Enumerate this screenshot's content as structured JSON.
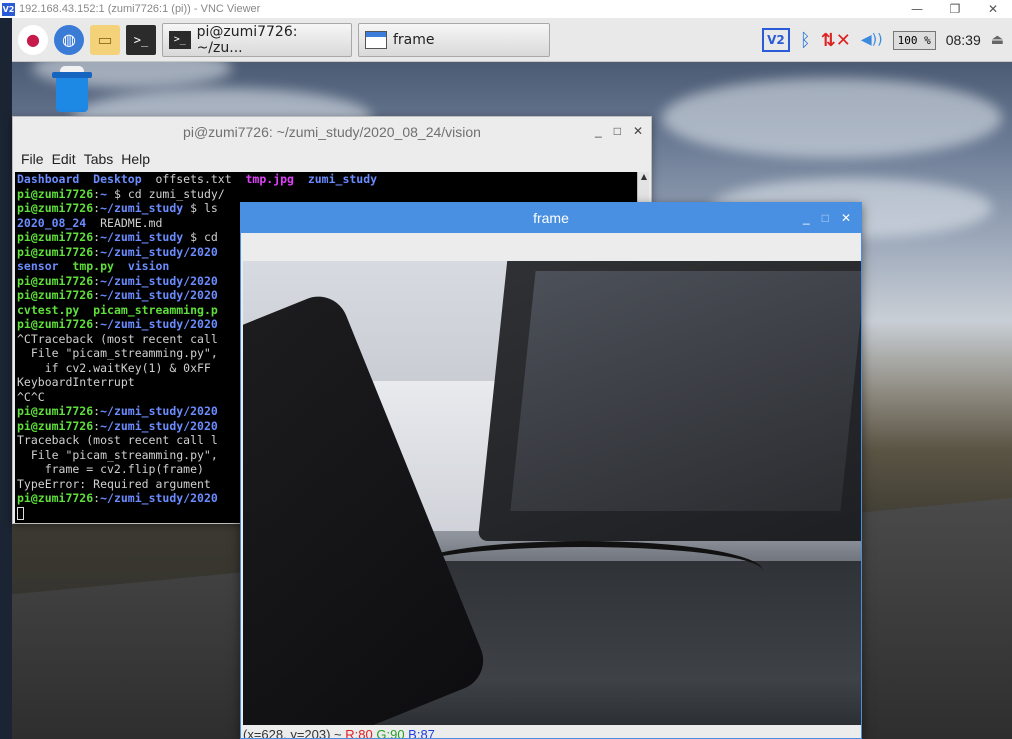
{
  "vnc": {
    "title": "192.168.43.152:1 (zumi7726:1 (pi)) - VNC Viewer",
    "logo": "V2",
    "minimize": "—",
    "restore": "❐",
    "close": "✕"
  },
  "taskbar": {
    "icons": [
      "raspberry-icon",
      "globe-icon",
      "folder-icon",
      "terminal-icon"
    ],
    "tasks": [
      {
        "label": "pi@zumi7726: ~/zu..."
      },
      {
        "label": "frame"
      }
    ],
    "tray": {
      "vnc": "V2",
      "cpu": "100 %",
      "clock": "08:39"
    }
  },
  "terminal": {
    "title": "pi@zumi7726: ~/zumi_study/2020_08_24/vision",
    "menu": [
      "File",
      "Edit",
      "Tabs",
      "Help"
    ],
    "lines": [
      [
        {
          "t": "Dashboard",
          "c": "b"
        },
        {
          "t": "  "
        },
        {
          "t": "Desktop",
          "c": "b"
        },
        {
          "t": "  offsets.txt  "
        },
        {
          "t": "tmp.jpg",
          "c": "m"
        },
        {
          "t": "  "
        },
        {
          "t": "zumi_study",
          "c": "b"
        }
      ],
      [
        {
          "t": "pi@zumi7726",
          "c": "g"
        },
        {
          "t": ":"
        },
        {
          "t": "~",
          "c": "b"
        },
        {
          "t": " $ cd zumi_study/"
        }
      ],
      [
        {
          "t": "pi@zumi7726",
          "c": "g"
        },
        {
          "t": ":"
        },
        {
          "t": "~/zumi_study",
          "c": "b"
        },
        {
          "t": " $ ls"
        }
      ],
      [
        {
          "t": "2020_08_24",
          "c": "b"
        },
        {
          "t": "  README.md"
        }
      ],
      [
        {
          "t": "pi@zumi7726",
          "c": "g"
        },
        {
          "t": ":"
        },
        {
          "t": "~/zumi_study",
          "c": "b"
        },
        {
          "t": " $ cd"
        }
      ],
      [
        {
          "t": "pi@zumi7726",
          "c": "g"
        },
        {
          "t": ":"
        },
        {
          "t": "~/zumi_study/2020",
          "c": "b"
        }
      ],
      [
        {
          "t": "sensor",
          "c": "b"
        },
        {
          "t": "  "
        },
        {
          "t": "tmp.py",
          "c": "g"
        },
        {
          "t": "  "
        },
        {
          "t": "vision",
          "c": "b"
        }
      ],
      [
        {
          "t": "pi@zumi7726",
          "c": "g"
        },
        {
          "t": ":"
        },
        {
          "t": "~/zumi_study/2020",
          "c": "b"
        }
      ],
      [
        {
          "t": "pi@zumi7726",
          "c": "g"
        },
        {
          "t": ":"
        },
        {
          "t": "~/zumi_study/2020",
          "c": "b"
        }
      ],
      [
        {
          "t": "cvtest.py",
          "c": "g"
        },
        {
          "t": "  "
        },
        {
          "t": "picam_streamming.p",
          "c": "g"
        }
      ],
      [
        {
          "t": "pi@zumi7726",
          "c": "g"
        },
        {
          "t": ":"
        },
        {
          "t": "~/zumi_study/2020",
          "c": "b"
        }
      ],
      [
        {
          "t": "^CTraceback (most recent call"
        }
      ],
      [
        {
          "t": "  File \"picam_streamming.py\","
        }
      ],
      [
        {
          "t": "    if cv2.waitKey(1) & 0xFF"
        }
      ],
      [
        {
          "t": "KeyboardInterrupt"
        }
      ],
      [
        {
          "t": "^C^C"
        }
      ],
      [
        {
          "t": "pi@zumi7726",
          "c": "g"
        },
        {
          "t": ":"
        },
        {
          "t": "~/zumi_study/2020",
          "c": "b"
        }
      ],
      [
        {
          "t": "pi@zumi7726",
          "c": "g"
        },
        {
          "t": ":"
        },
        {
          "t": "~/zumi_study/2020",
          "c": "b"
        }
      ],
      [
        {
          "t": "Traceback (most recent call l"
        }
      ],
      [
        {
          "t": "  File \"picam_streamming.py\","
        }
      ],
      [
        {
          "t": "    frame = cv2.flip(frame)"
        }
      ],
      [
        {
          "t": "TypeError: Required argument"
        }
      ],
      [
        {
          "t": "pi@zumi7726",
          "c": "g"
        },
        {
          "t": ":"
        },
        {
          "t": "~/zumi_study/2020",
          "c": "b"
        }
      ]
    ]
  },
  "frame": {
    "title": "frame",
    "status": {
      "coords": "(x=628, y=203) ~ ",
      "r": "R:80",
      "g": "G:90",
      "b": "B:87"
    }
  }
}
